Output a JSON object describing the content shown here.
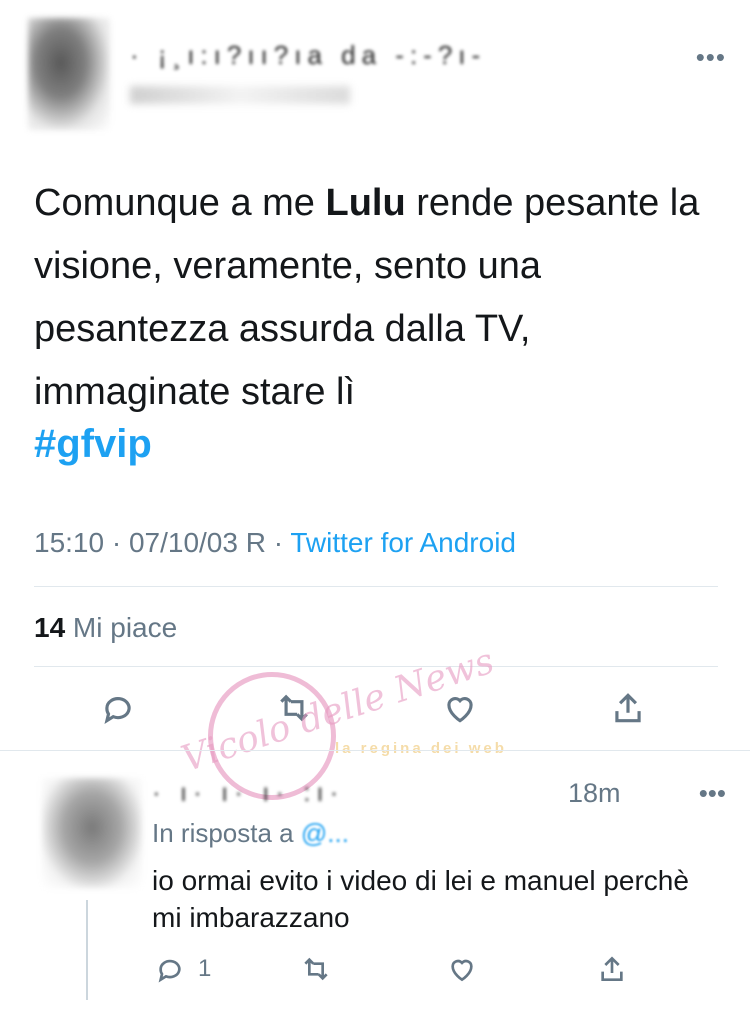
{
  "header": {
    "author_name_obscured": "· ¡¸ı:ı?ıı?ıa da  -:-?ı-",
    "more_label": "•••"
  },
  "tweet": {
    "text_part1": "Comunque a me ",
    "text_bold": "Lulu",
    "text_part2": " rende pesante la visione, veramente, sento una pesantezza assurda dalla TV, immaginate stare lì",
    "hashtag": "#gfvip",
    "timestamp": "15:10 · 07/10/03 R · ",
    "source": "Twitter for Android",
    "likes_count": "14",
    "likes_label": " Mi piace"
  },
  "actions": {
    "icons": [
      "reply-icon",
      "retweet-icon",
      "like-icon",
      "share-icon"
    ]
  },
  "watermark": {
    "text": "Vicolo delle News",
    "band": "la regina dei web"
  },
  "reply": {
    "author_obscured": "· ı· ı· ı· :ı·",
    "time": "18m",
    "more_label": "•••",
    "in_reply_prefix": "In risposta a ",
    "in_reply_handle": "@...",
    "text": "io ormai evito i video di lei e manuel perchè mi imbarazzano",
    "reply_count": "1"
  },
  "colors": {
    "accent": "#1da1f2",
    "text_primary": "#14171a",
    "text_secondary": "#657786",
    "divider": "#e1e8ed",
    "watermark_pink": "#e9a5c8"
  }
}
